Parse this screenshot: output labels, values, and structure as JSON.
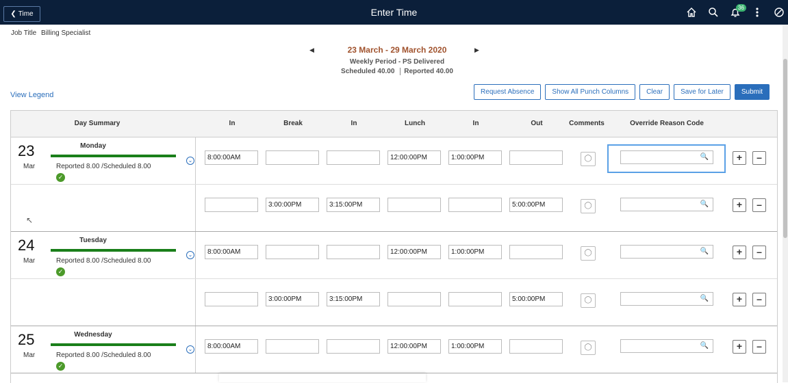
{
  "header": {
    "back_label": "Time",
    "title": "Enter Time",
    "notification_count": "36"
  },
  "job": {
    "label": "Job Title",
    "value": "Billing Specialist"
  },
  "period": {
    "range": "23 March - 29 March 2020",
    "type": "Weekly Period - PS Delivered",
    "scheduled_label": "Scheduled",
    "scheduled_value": "40.00",
    "reported_label": "Reported",
    "reported_value": "40.00"
  },
  "legend_link": "View Legend",
  "actions": {
    "request_absence": "Request Absence",
    "show_all": "Show All Punch Columns",
    "clear": "Clear",
    "save_later": "Save for Later",
    "submit": "Submit"
  },
  "columns": [
    "Day Summary",
    "In",
    "Break",
    "In",
    "Lunch",
    "In",
    "Out",
    "Comments",
    "Override Reason Code"
  ],
  "days": [
    {
      "num": "23",
      "month": "Mar",
      "name": "Monday",
      "reported": "Reported 8.00 /Scheduled 8.00",
      "rows": [
        [
          "8:00:00AM",
          "",
          "",
          "12:00:00PM",
          "1:00:00PM",
          ""
        ],
        [
          "",
          "3:00:00PM",
          "3:15:00PM",
          "",
          "",
          "5:00:00PM"
        ]
      ]
    },
    {
      "num": "24",
      "month": "Mar",
      "name": "Tuesday",
      "reported": "Reported 8.00 /Scheduled 8.00",
      "rows": [
        [
          "8:00:00AM",
          "",
          "",
          "12:00:00PM",
          "1:00:00PM",
          ""
        ],
        [
          "",
          "3:00:00PM",
          "3:15:00PM",
          "",
          "",
          "5:00:00PM"
        ]
      ]
    },
    {
      "num": "25",
      "month": "Mar",
      "name": "Wednesday",
      "reported": "Reported 8.00 /Scheduled 8.00",
      "rows": [
        [
          "8:00:00AM",
          "",
          "",
          "12:00:00PM",
          "1:00:00PM",
          ""
        ]
      ]
    }
  ],
  "icons": {
    "home": "home-icon",
    "search": "search-icon",
    "bell": "bell-icon",
    "more": "more-icon",
    "nav": "compass-icon"
  },
  "colors": {
    "topbar": "#0b1f3a",
    "accent": "#2a6ebb",
    "status_green": "#1a7f1a",
    "period_range": "#a0522d"
  }
}
